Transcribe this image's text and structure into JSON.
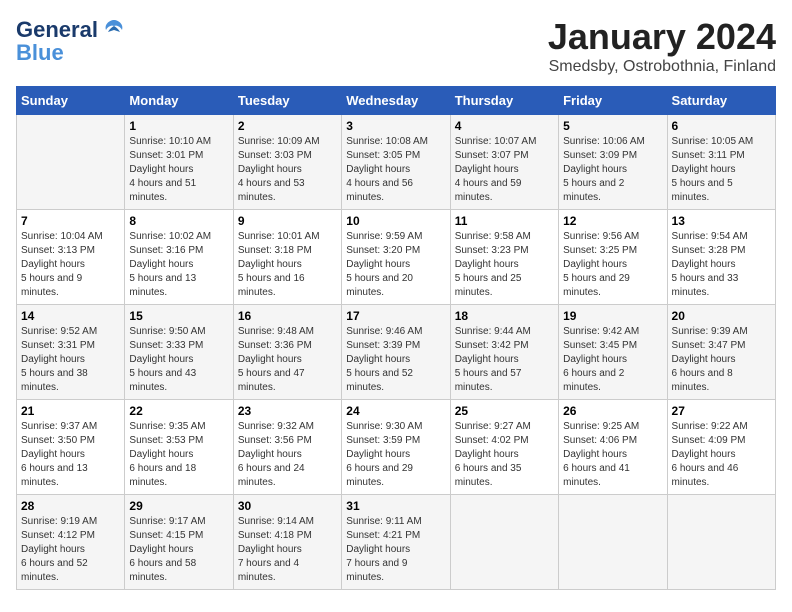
{
  "header": {
    "logo_line1": "General",
    "logo_line2": "Blue",
    "month": "January 2024",
    "location": "Smedsby, Ostrobothnia, Finland"
  },
  "weekdays": [
    "Sunday",
    "Monday",
    "Tuesday",
    "Wednesday",
    "Thursday",
    "Friday",
    "Saturday"
  ],
  "weeks": [
    [
      {
        "day": "",
        "sunrise": "",
        "sunset": "",
        "daylight": ""
      },
      {
        "day": "1",
        "sunrise": "10:10 AM",
        "sunset": "3:01 PM",
        "daylight": "4 hours and 51 minutes."
      },
      {
        "day": "2",
        "sunrise": "10:09 AM",
        "sunset": "3:03 PM",
        "daylight": "4 hours and 53 minutes."
      },
      {
        "day": "3",
        "sunrise": "10:08 AM",
        "sunset": "3:05 PM",
        "daylight": "4 hours and 56 minutes."
      },
      {
        "day": "4",
        "sunrise": "10:07 AM",
        "sunset": "3:07 PM",
        "daylight": "4 hours and 59 minutes."
      },
      {
        "day": "5",
        "sunrise": "10:06 AM",
        "sunset": "3:09 PM",
        "daylight": "5 hours and 2 minutes."
      },
      {
        "day": "6",
        "sunrise": "10:05 AM",
        "sunset": "3:11 PM",
        "daylight": "5 hours and 5 minutes."
      }
    ],
    [
      {
        "day": "7",
        "sunrise": "10:04 AM",
        "sunset": "3:13 PM",
        "daylight": "5 hours and 9 minutes."
      },
      {
        "day": "8",
        "sunrise": "10:02 AM",
        "sunset": "3:16 PM",
        "daylight": "5 hours and 13 minutes."
      },
      {
        "day": "9",
        "sunrise": "10:01 AM",
        "sunset": "3:18 PM",
        "daylight": "5 hours and 16 minutes."
      },
      {
        "day": "10",
        "sunrise": "9:59 AM",
        "sunset": "3:20 PM",
        "daylight": "5 hours and 20 minutes."
      },
      {
        "day": "11",
        "sunrise": "9:58 AM",
        "sunset": "3:23 PM",
        "daylight": "5 hours and 25 minutes."
      },
      {
        "day": "12",
        "sunrise": "9:56 AM",
        "sunset": "3:25 PM",
        "daylight": "5 hours and 29 minutes."
      },
      {
        "day": "13",
        "sunrise": "9:54 AM",
        "sunset": "3:28 PM",
        "daylight": "5 hours and 33 minutes."
      }
    ],
    [
      {
        "day": "14",
        "sunrise": "9:52 AM",
        "sunset": "3:31 PM",
        "daylight": "5 hours and 38 minutes."
      },
      {
        "day": "15",
        "sunrise": "9:50 AM",
        "sunset": "3:33 PM",
        "daylight": "5 hours and 43 minutes."
      },
      {
        "day": "16",
        "sunrise": "9:48 AM",
        "sunset": "3:36 PM",
        "daylight": "5 hours and 47 minutes."
      },
      {
        "day": "17",
        "sunrise": "9:46 AM",
        "sunset": "3:39 PM",
        "daylight": "5 hours and 52 minutes."
      },
      {
        "day": "18",
        "sunrise": "9:44 AM",
        "sunset": "3:42 PM",
        "daylight": "5 hours and 57 minutes."
      },
      {
        "day": "19",
        "sunrise": "9:42 AM",
        "sunset": "3:45 PM",
        "daylight": "6 hours and 2 minutes."
      },
      {
        "day": "20",
        "sunrise": "9:39 AM",
        "sunset": "3:47 PM",
        "daylight": "6 hours and 8 minutes."
      }
    ],
    [
      {
        "day": "21",
        "sunrise": "9:37 AM",
        "sunset": "3:50 PM",
        "daylight": "6 hours and 13 minutes."
      },
      {
        "day": "22",
        "sunrise": "9:35 AM",
        "sunset": "3:53 PM",
        "daylight": "6 hours and 18 minutes."
      },
      {
        "day": "23",
        "sunrise": "9:32 AM",
        "sunset": "3:56 PM",
        "daylight": "6 hours and 24 minutes."
      },
      {
        "day": "24",
        "sunrise": "9:30 AM",
        "sunset": "3:59 PM",
        "daylight": "6 hours and 29 minutes."
      },
      {
        "day": "25",
        "sunrise": "9:27 AM",
        "sunset": "4:02 PM",
        "daylight": "6 hours and 35 minutes."
      },
      {
        "day": "26",
        "sunrise": "9:25 AM",
        "sunset": "4:06 PM",
        "daylight": "6 hours and 41 minutes."
      },
      {
        "day": "27",
        "sunrise": "9:22 AM",
        "sunset": "4:09 PM",
        "daylight": "6 hours and 46 minutes."
      }
    ],
    [
      {
        "day": "28",
        "sunrise": "9:19 AM",
        "sunset": "4:12 PM",
        "daylight": "6 hours and 52 minutes."
      },
      {
        "day": "29",
        "sunrise": "9:17 AM",
        "sunset": "4:15 PM",
        "daylight": "6 hours and 58 minutes."
      },
      {
        "day": "30",
        "sunrise": "9:14 AM",
        "sunset": "4:18 PM",
        "daylight": "7 hours and 4 minutes."
      },
      {
        "day": "31",
        "sunrise": "9:11 AM",
        "sunset": "4:21 PM",
        "daylight": "7 hours and 9 minutes."
      },
      {
        "day": "",
        "sunrise": "",
        "sunset": "",
        "daylight": ""
      },
      {
        "day": "",
        "sunrise": "",
        "sunset": "",
        "daylight": ""
      },
      {
        "day": "",
        "sunrise": "",
        "sunset": "",
        "daylight": ""
      }
    ]
  ]
}
